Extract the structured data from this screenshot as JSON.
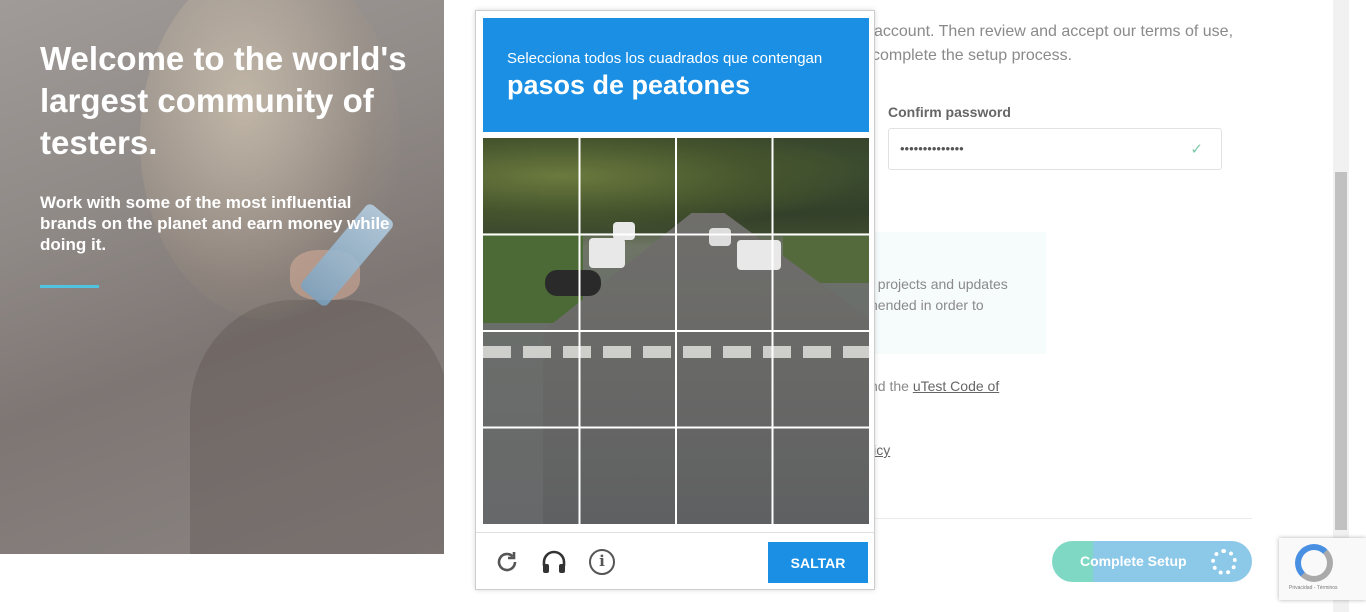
{
  "hero": {
    "title": "Welcome to the world's largest community of testers.",
    "subtitle": "Work with some of the most influential brands on the planet and earn money while doing it."
  },
  "form": {
    "intro_line1": "account. Then review and accept our terms of use,",
    "intro_line2": "complete the setup process.",
    "confirm_label": "Confirm password",
    "confirm_value": "••••••••••••••",
    "info_text": "t projects and updates\nnended in order to",
    "terms_prefix": "nd the ",
    "terms_link": "uTest Code of",
    "policy_link": "licy",
    "complete_button": "Complete Setup"
  },
  "captcha": {
    "instruction": "Selecciona todos los cuadrados que contengan",
    "target": "pasos de peatones",
    "skip_button": "SALTAR",
    "icons": [
      "reload-icon",
      "headphones-icon",
      "info-icon"
    ],
    "accent_color": "#1a8fe3"
  },
  "badge": {
    "fine_print": "Privacidad - Términos"
  }
}
